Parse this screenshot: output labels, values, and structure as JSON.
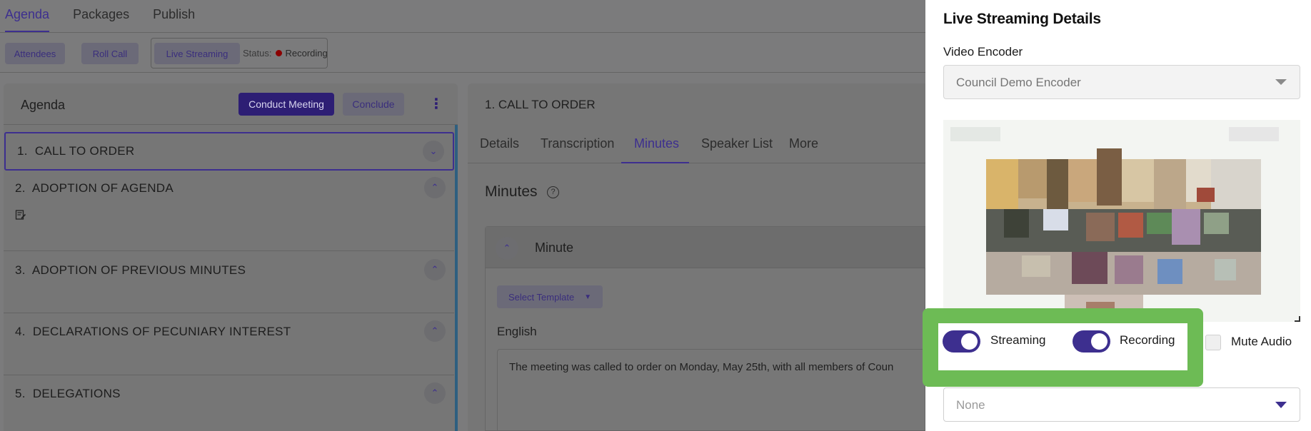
{
  "topnav": {
    "tabs": [
      "Agenda",
      "Packages",
      "Publish"
    ],
    "active": "Agenda"
  },
  "toolbar": {
    "attendees": "Attendees",
    "roll_call": "Roll Call",
    "live_streaming": "Live Streaming",
    "status_label": "Status:",
    "status_value": "Recording",
    "status_color": "#8b0000"
  },
  "agenda": {
    "title": "Agenda",
    "conduct": "Conduct Meeting",
    "conclude": "Conclude",
    "items": [
      {
        "num": "1.",
        "title": "CALL TO ORDER"
      },
      {
        "num": "2.",
        "title": "ADOPTION OF AGENDA"
      },
      {
        "num": "3.",
        "title": "ADOPTION OF PREVIOUS MINUTES"
      },
      {
        "num": "4.",
        "title": "DECLARATIONS OF PECUNIARY INTEREST"
      },
      {
        "num": "5.",
        "title": "DELEGATIONS"
      }
    ]
  },
  "detail": {
    "title": "1. CALL TO ORDER",
    "tabs": [
      "Details",
      "Transcription",
      "Minutes",
      "Speaker List",
      "More"
    ],
    "active_tab": "Minutes",
    "section_title": "Minutes",
    "minute_title": "Minute",
    "select_template": "Select Template",
    "language": "English",
    "minute_text": "The meeting was called to order on Monday, May 25th, with all members of Coun"
  },
  "drawer": {
    "title": "Live Streaming Details",
    "encoder_label": "Video Encoder",
    "encoder_value": "Council Demo Encoder",
    "streaming_label": "Streaming",
    "streaming_on": true,
    "recording_label": "Recording",
    "recording_on": true,
    "mute_label": "Mute Audio",
    "mute_checked": false,
    "caption_value": "None"
  },
  "colors": {
    "accent": "#3d2f8f",
    "highlight": "#6dbb55"
  }
}
